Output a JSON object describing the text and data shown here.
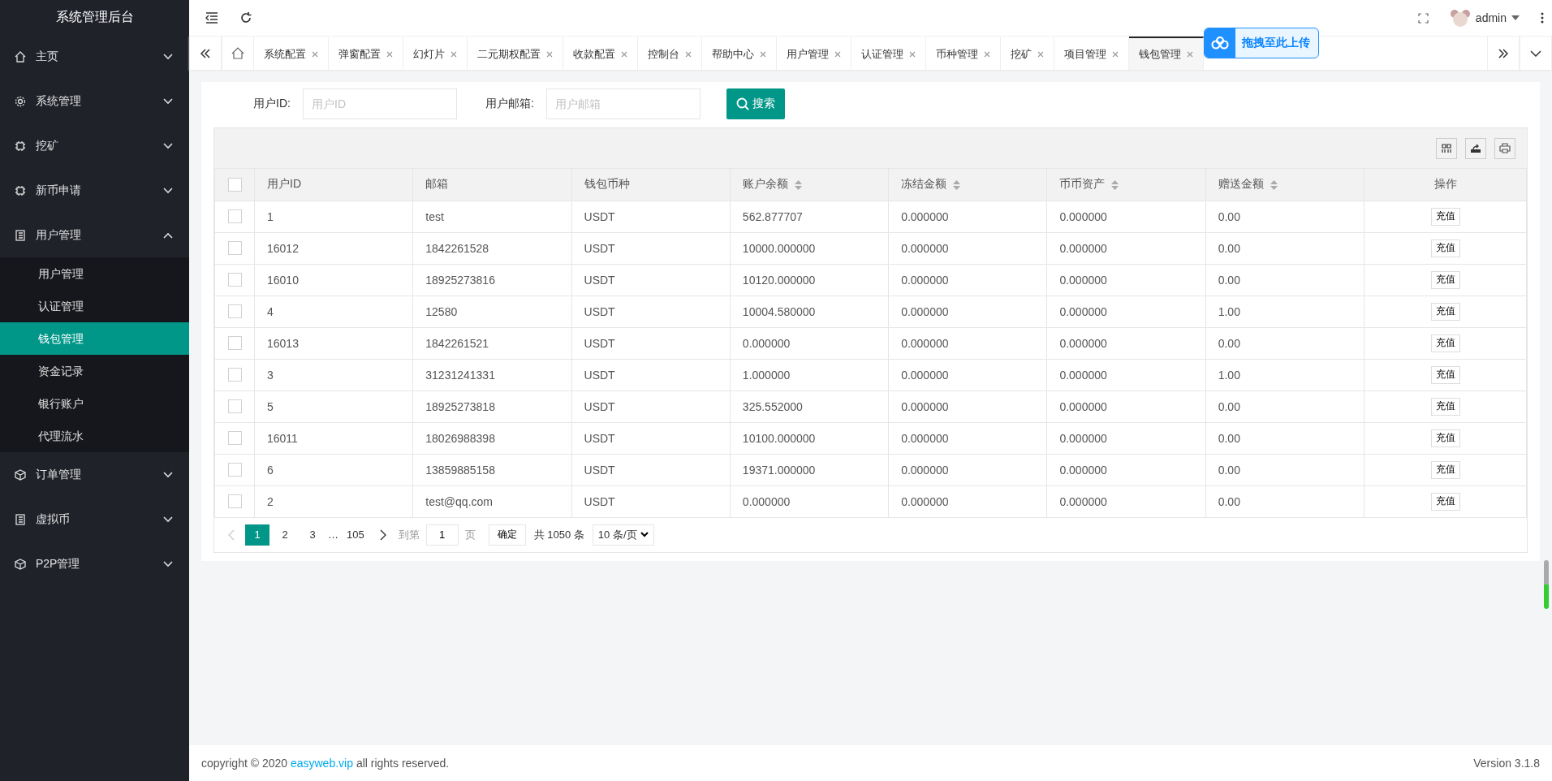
{
  "brand": "系统管理后台",
  "sidebar": {
    "items": [
      {
        "label": "主页",
        "expanded": false
      },
      {
        "label": "系统管理",
        "expanded": false
      },
      {
        "label": "挖矿",
        "expanded": false
      },
      {
        "label": "新币申请",
        "expanded": false
      },
      {
        "label": "用户管理",
        "expanded": true,
        "children": [
          {
            "label": "用户管理",
            "selected": false
          },
          {
            "label": "认证管理",
            "selected": false
          },
          {
            "label": "钱包管理",
            "selected": true
          },
          {
            "label": "资金记录",
            "selected": false
          },
          {
            "label": "银行账户",
            "selected": false
          },
          {
            "label": "代理流水",
            "selected": false
          }
        ]
      },
      {
        "label": "订单管理",
        "expanded": false
      },
      {
        "label": "虚拟币",
        "expanded": false
      },
      {
        "label": "P2P管理",
        "expanded": false
      }
    ]
  },
  "header": {
    "user": "admin"
  },
  "tabs": [
    {
      "label": "系统配置",
      "selected": false
    },
    {
      "label": "弹窗配置",
      "selected": false
    },
    {
      "label": "幻灯片",
      "selected": false
    },
    {
      "label": "二元期权配置",
      "selected": false
    },
    {
      "label": "收款配置",
      "selected": false
    },
    {
      "label": "控制台",
      "selected": false
    },
    {
      "label": "帮助中心",
      "selected": false
    },
    {
      "label": "用户管理",
      "selected": false
    },
    {
      "label": "认证管理",
      "selected": false
    },
    {
      "label": "币种管理",
      "selected": false
    },
    {
      "label": "挖矿",
      "selected": false
    },
    {
      "label": "项目管理",
      "selected": false
    },
    {
      "label": "钱包管理",
      "selected": true
    }
  ],
  "upload_badge": "拖拽至此上传",
  "search": {
    "fields": [
      {
        "label": "用户ID:",
        "placeholder": "用户ID"
      },
      {
        "label": "用户邮箱:",
        "placeholder": "用户邮箱"
      }
    ],
    "button": "搜索"
  },
  "table": {
    "select_all_checked": false,
    "columns": [
      {
        "label": "用户ID",
        "sortable": false
      },
      {
        "label": "邮箱",
        "sortable": false
      },
      {
        "label": "钱包币种",
        "sortable": false
      },
      {
        "label": "账户余额",
        "sortable": true
      },
      {
        "label": "冻结金额",
        "sortable": true
      },
      {
        "label": "币币资产",
        "sortable": true
      },
      {
        "label": "赠送金额",
        "sortable": true
      },
      {
        "label": "操作",
        "sortable": false
      }
    ],
    "rows": [
      {
        "checked": false,
        "cells": [
          "1",
          "test",
          "USDT",
          "562.877707",
          "0.000000",
          "0.000000",
          "0.00"
        ],
        "action": "充值"
      },
      {
        "checked": false,
        "cells": [
          "16012",
          "1842261528",
          "USDT",
          "10000.000000",
          "0.000000",
          "0.000000",
          "0.00"
        ],
        "action": "充值"
      },
      {
        "checked": false,
        "cells": [
          "16010",
          "18925273816",
          "USDT",
          "10120.000000",
          "0.000000",
          "0.000000",
          "0.00"
        ],
        "action": "充值"
      },
      {
        "checked": false,
        "cells": [
          "4",
          "12580",
          "USDT",
          "10004.580000",
          "0.000000",
          "0.000000",
          "1.00"
        ],
        "action": "充值"
      },
      {
        "checked": false,
        "cells": [
          "16013",
          "1842261521",
          "USDT",
          "0.000000",
          "0.000000",
          "0.000000",
          "0.00"
        ],
        "action": "充值"
      },
      {
        "checked": false,
        "cells": [
          "3",
          "31231241331",
          "USDT",
          "1.000000",
          "0.000000",
          "0.000000",
          "1.00"
        ],
        "action": "充值"
      },
      {
        "checked": false,
        "cells": [
          "5",
          "18925273818",
          "USDT",
          "325.552000",
          "0.000000",
          "0.000000",
          "0.00"
        ],
        "action": "充值"
      },
      {
        "checked": false,
        "cells": [
          "16011",
          "18026988398",
          "USDT",
          "10100.000000",
          "0.000000",
          "0.000000",
          "0.00"
        ],
        "action": "充值"
      },
      {
        "checked": false,
        "cells": [
          "6",
          "13859885158",
          "USDT",
          "19371.000000",
          "0.000000",
          "0.000000",
          "0.00"
        ],
        "action": "充值"
      },
      {
        "checked": false,
        "cells": [
          "2",
          "test@qq.com",
          "USDT",
          "0.000000",
          "0.000000",
          "0.000000",
          "0.00"
        ],
        "action": "充值"
      }
    ]
  },
  "pagination": {
    "pages": [
      {
        "label": "1",
        "selected": true
      },
      {
        "label": "2",
        "selected": false
      },
      {
        "label": "3",
        "selected": false
      }
    ],
    "ellipsis": "…",
    "last": "105",
    "goto_label": "到第",
    "goto_value": "1",
    "page_unit": "页",
    "confirm": "确定",
    "total": "共 1050 条",
    "page_size": "10 条/页"
  },
  "footer": {
    "copyright": "copyright © 2020",
    "link": "easyweb.vip",
    "rights": "all rights reserved.",
    "version": "Version 3.1.8"
  }
}
